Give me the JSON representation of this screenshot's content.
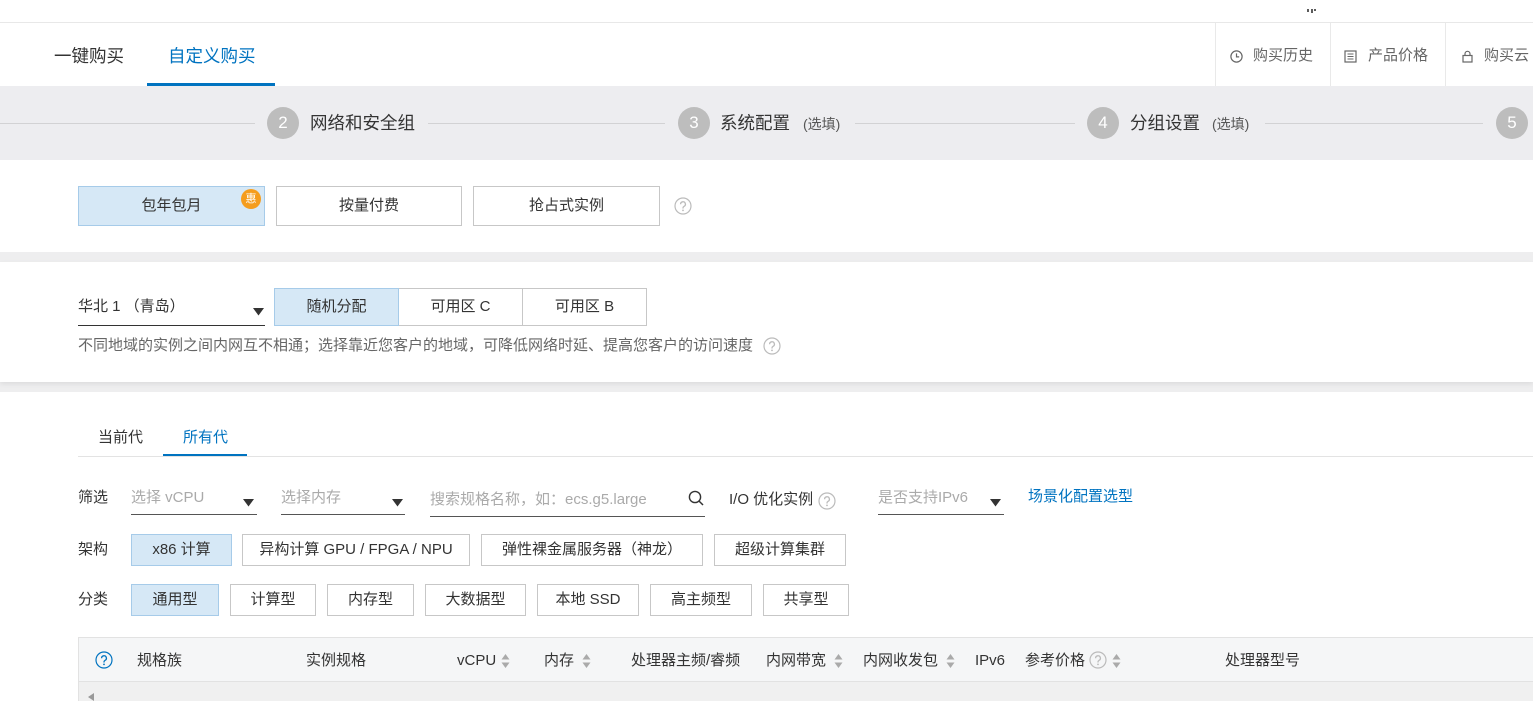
{
  "colors": {
    "accent": "#0073c0",
    "selected_bg": "#d6e8f6",
    "badge": "#f59d1e",
    "step_circle": "#bdbdbd"
  },
  "top_tabs": {
    "active_index": 1,
    "items": [
      {
        "label": "一键购买"
      },
      {
        "label": "自定义购买"
      }
    ]
  },
  "top_links": [
    {
      "label": "购买历史",
      "icon": "clock-icon"
    },
    {
      "label": "产品价格",
      "icon": "list-icon"
    },
    {
      "label": "购买云",
      "icon": "lock-icon"
    }
  ],
  "steps": [
    {
      "number": "2",
      "label": "网络和安全组"
    },
    {
      "number": "3",
      "label": "系统配置",
      "note": "(选填)"
    },
    {
      "number": "4",
      "label": "分组设置",
      "note": "(选填)"
    },
    {
      "number": "5"
    }
  ],
  "billing": {
    "selected_index": 0,
    "options": [
      "包年包月",
      "按量付费",
      "抢占式实例"
    ],
    "badge": "惠",
    "help_icon": "question-icon"
  },
  "region": {
    "value": "华北 1 （青岛）",
    "selected_zone_index": 0,
    "zones": [
      "随机分配",
      "可用区 C",
      "可用区 B"
    ],
    "hint": "不同地域的实例之间内网互不相通；选择靠近您客户的地域，可降低网络时延、提高您客户的访问速度",
    "help_icon": "question-icon"
  },
  "generation_tabs": {
    "active_index": 1,
    "items": [
      "当前代",
      "所有代"
    ]
  },
  "filter": {
    "label": "筛选",
    "vcpu_placeholder": "选择 vCPU",
    "memory_placeholder": "选择内存",
    "search_placeholder": "搜索规格名称，如：ecs.g5.large",
    "io_label": "I/O 优化实例",
    "ipv6_placeholder": "是否支持IPv6",
    "scenario_link": "场景化配置选型"
  },
  "architecture": {
    "label": "架构",
    "selected_index": 0,
    "options": [
      "x86 计算",
      "异构计算 GPU / FPGA / NPU",
      "弹性裸金属服务器（神龙）",
      "超级计算集群"
    ]
  },
  "category": {
    "label": "分类",
    "selected_index": 0,
    "options": [
      "通用型",
      "计算型",
      "内存型",
      "大数据型",
      "本地 SSD",
      "高主频型",
      "共享型"
    ]
  },
  "spec_table": {
    "columns": [
      {
        "label": "规格族"
      },
      {
        "label": "实例规格"
      },
      {
        "label": "vCPU",
        "sortable": true
      },
      {
        "label": "内存",
        "sortable": true
      },
      {
        "label": "处理器主频/睿频"
      },
      {
        "label": "内网带宽",
        "sortable": true
      },
      {
        "label": "内网收发包",
        "sortable": true
      },
      {
        "label": "IPv6"
      },
      {
        "label": "参考价格",
        "sortable": true,
        "help_icon": "question-icon"
      },
      {
        "label": "处理器型号"
      }
    ]
  }
}
